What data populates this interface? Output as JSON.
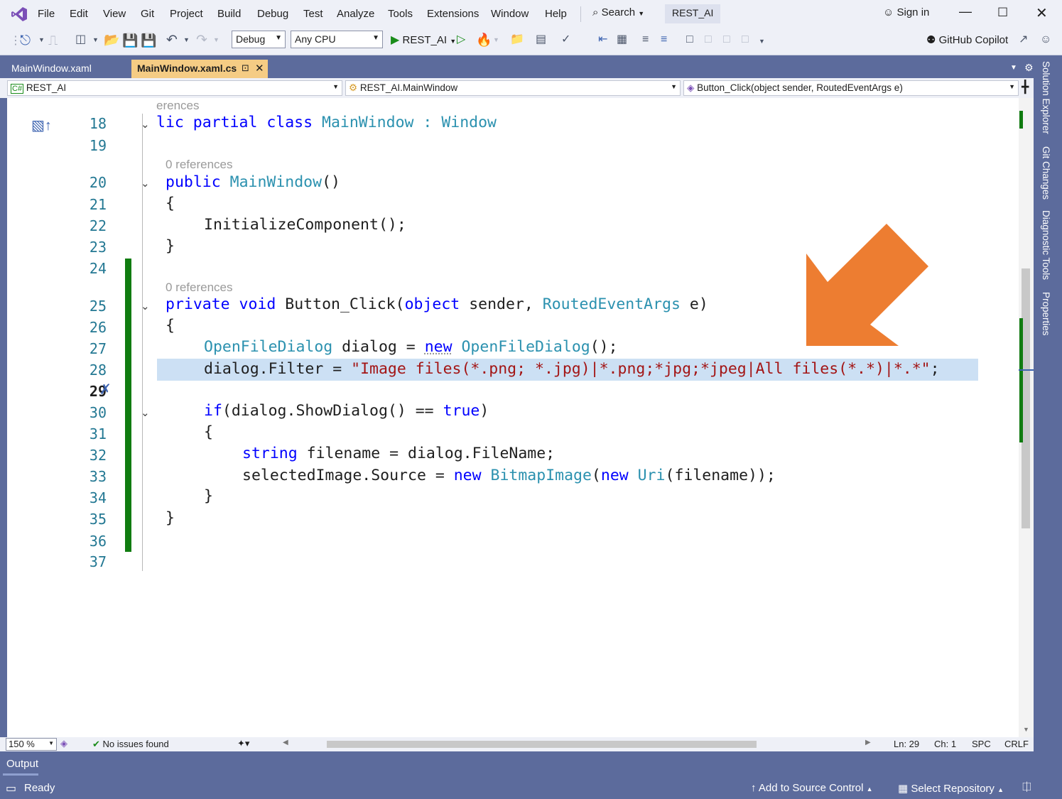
{
  "menu": [
    "File",
    "Edit",
    "View",
    "Git",
    "Project",
    "Build",
    "Debug",
    "Test",
    "Analyze",
    "Tools",
    "Extensions",
    "Window",
    "Help"
  ],
  "search_label": "Search",
  "solution_badge": "REST_AI",
  "sign_in": "Sign in",
  "toolbar": {
    "config": "Debug",
    "platform": "Any CPU",
    "run_target": "REST_AI",
    "copilot": "GitHub Copilot"
  },
  "tabs": [
    {
      "label": "MainWindow.xaml",
      "active": false
    },
    {
      "label": "MainWindow.xaml.cs",
      "active": true
    }
  ],
  "nav": {
    "project": "REST_AI",
    "class": "REST_AI.MainWindow",
    "member": "Button_Click(object sender, RoutedEventArgs e)"
  },
  "lens": {
    "top_partial": "erences",
    "ctor": "0 references",
    "handler": "0 references"
  },
  "lines": [
    "18",
    "19",
    "20",
    "21",
    "22",
    "23",
    "24",
    "25",
    "26",
    "27",
    "28",
    "29",
    "30",
    "31",
    "32",
    "33",
    "34",
    "35",
    "36",
    "37"
  ],
  "code": {
    "l18a": "lic partial class",
    "l18b": "MainWindow",
    "l18c": ":",
    "l18d": "Window",
    "l20a": "public",
    "l20b": "MainWindow",
    "l20c": "()",
    "brace_open": "{",
    "brace_close": "}",
    "l22": "InitializeComponent();",
    "l25a": "private void",
    "l25b": "Button_Click(",
    "l25c": "object",
    "l25d": "sender,",
    "l25e": "RoutedEventArgs",
    "l25f": "e)",
    "l27a": "OpenFileDialog",
    "l27b": "dialog =",
    "l27c": "new",
    "l27d": "OpenFileDialog",
    "l27e": "();",
    "l28a": "dialog.Filter =",
    "l28b": "\"Image files(*.png; *.jpg)|*.png;*jpg;*jpeg|All files(*.*)|*.*\"",
    "l28c": ";",
    "l30a": "if",
    "l30b": "(dialog.ShowDialog() ==",
    "l30c": "true",
    "l30d": ")",
    "l32a": "string",
    "l32b": "filename = dialog.FileName;",
    "l33a": "selectedImage.Source =",
    "l33b": "new",
    "l33c": "BitmapImage",
    "l33d": "(",
    "l33e": "new",
    "l33f": "Uri",
    "l33g": "(filename));"
  },
  "status": {
    "zoom": "150 %",
    "issues": "No issues found",
    "ln": "Ln: 29",
    "ch": "Ch: 1",
    "spc": "SPC",
    "crlf": "CRLF"
  },
  "output_label": "Output",
  "statusbar": {
    "ready": "Ready",
    "source_control": "Add to Source Control",
    "repository": "Select Repository"
  },
  "side_tabs": [
    "Solution Explorer",
    "Git Changes",
    "Diagnostic Tools",
    "Properties"
  ],
  "colors": {
    "accent_arrow": "#ed7d31",
    "change_bar": "#107c10",
    "highlight": "#cce0f4"
  }
}
